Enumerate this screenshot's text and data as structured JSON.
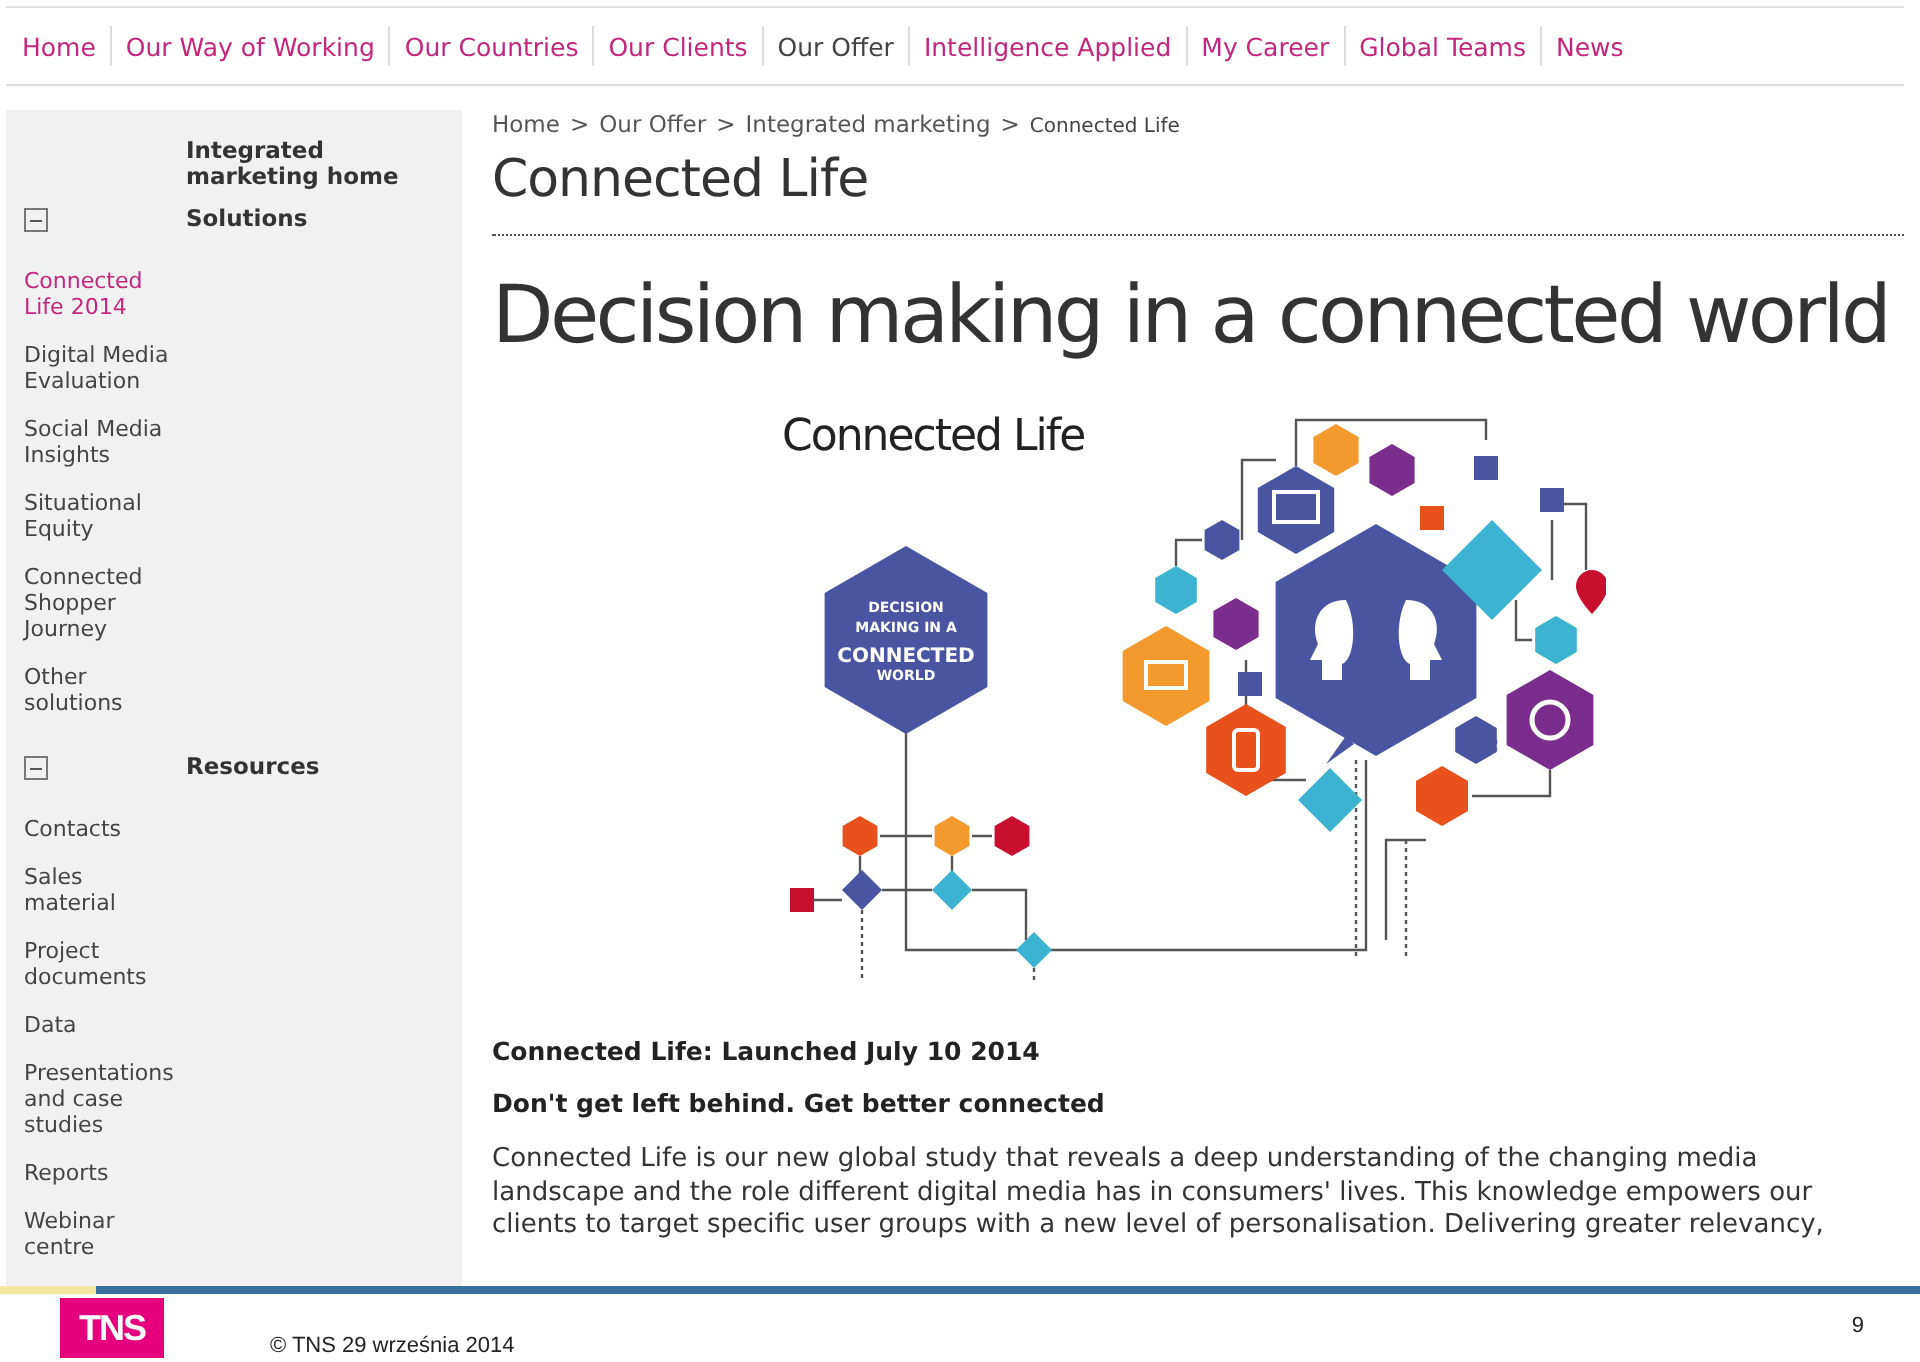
{
  "nav": [
    {
      "label": "Home",
      "selected": false
    },
    {
      "label": "Our Way of Working",
      "selected": false
    },
    {
      "label": "Our Countries",
      "selected": false
    },
    {
      "label": "Our Clients",
      "selected": false
    },
    {
      "label": "Our Offer",
      "selected": true
    },
    {
      "label": "Intelligence Applied",
      "selected": false
    },
    {
      "label": "My Career",
      "selected": false
    },
    {
      "label": "Global Teams",
      "selected": false
    },
    {
      "label": "News",
      "selected": false
    }
  ],
  "sidebar": {
    "home_link": "Integrated marketing home",
    "sections": [
      {
        "title": "Solutions",
        "expanded": true,
        "items": [
          {
            "label": "Connected Life 2014",
            "selected": true
          },
          {
            "label": "Digital Media Evaluation",
            "selected": false
          },
          {
            "label": "Social Media Insights",
            "selected": false
          },
          {
            "label": "Situational Equity",
            "selected": false
          },
          {
            "label": "Connected Shopper Journey",
            "selected": false
          },
          {
            "label": "Other solutions",
            "selected": false
          }
        ]
      },
      {
        "title": "Resources",
        "expanded": true,
        "items": [
          {
            "label": "Contacts",
            "selected": false
          },
          {
            "label": "Sales material",
            "selected": false
          },
          {
            "label": "Project documents",
            "selected": false
          },
          {
            "label": "Data",
            "selected": false
          },
          {
            "label": "Presentations and case studies",
            "selected": false
          },
          {
            "label": "Reports",
            "selected": false
          },
          {
            "label": "Webinar centre",
            "selected": false
          }
        ]
      }
    ]
  },
  "breadcrumb": {
    "separator": ">",
    "items": [
      "Home",
      "Our Offer",
      "Integrated marketing",
      "Connected Life"
    ]
  },
  "page_title": "Connected Life",
  "headline": "Decision making in a connected world",
  "infographic": {
    "title": "Connected Life",
    "badge_lines": [
      "DECISION",
      "MAKING IN A",
      "CONNECTED",
      "WORLD"
    ]
  },
  "subheading_1": "Connected Life:  Launched July 10 2014",
  "subheading_2": "Don't get left behind. Get better connected",
  "body": "Connected Life is our new global study that reveals a deep understanding of the changing media landscape and the role different digital media has in consumers' lives. This knowledge empowers our clients to target specific user groups with a new level of personalisation. Delivering greater relevancy,",
  "footer": {
    "logo": "TNS",
    "text": "© TNS 29 września 2014",
    "page_number": "9"
  }
}
